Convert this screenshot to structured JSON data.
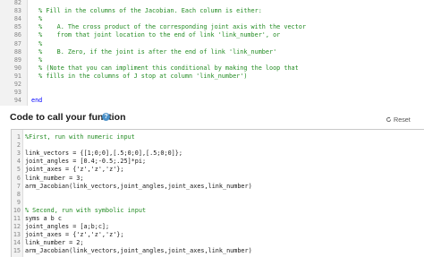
{
  "top_editor": {
    "lines": [
      {
        "n": "82",
        "text": "",
        "type": "plain"
      },
      {
        "n": "83",
        "text": "  % Fill in the columns of the Jacobian. Each column is either:",
        "type": "comment"
      },
      {
        "n": "84",
        "text": "  %",
        "type": "comment"
      },
      {
        "n": "85",
        "text": "  %    A. The cross product of the corresponding joint axis with the vector",
        "type": "comment"
      },
      {
        "n": "86",
        "text": "  %    from that joint location to the end of link 'link_number', or",
        "type": "comment"
      },
      {
        "n": "87",
        "text": "  %",
        "type": "comment"
      },
      {
        "n": "88",
        "text": "  %    B. Zero, if the joint is after the end of link 'link_number'",
        "type": "comment"
      },
      {
        "n": "89",
        "text": "  %",
        "type": "comment"
      },
      {
        "n": "90",
        "text": "  % (Note that you can impliment this conditional by making the loop that",
        "type": "comment"
      },
      {
        "n": "91",
        "text": "  % fills in the columns of J stop at column 'link_number')",
        "type": "comment"
      },
      {
        "n": "92",
        "text": "",
        "type": "plain"
      },
      {
        "n": "93",
        "text": "",
        "type": "plain"
      },
      {
        "n": "94",
        "text": "end",
        "type": "keyword"
      }
    ]
  },
  "section": {
    "title": "Code to call your function",
    "help_icon": "?",
    "reset_label": "Reset"
  },
  "bottom_editor": {
    "lines": [
      {
        "n": "1",
        "text": "%First, run with numeric input",
        "type": "comment"
      },
      {
        "n": "2",
        "text": "",
        "type": "plain"
      },
      {
        "n": "3",
        "text": "link_vectors = {[1;0;0],[.5;0;0],[.5;0;0]};",
        "type": "plain"
      },
      {
        "n": "4",
        "text": "joint_angles = [0.4;-0.5;.25]*pi;",
        "type": "plain"
      },
      {
        "n": "5",
        "text": "joint_axes = {'z','z','z'};",
        "type": "plain"
      },
      {
        "n": "6",
        "text": "link_number = 3;",
        "type": "plain"
      },
      {
        "n": "7",
        "text": "arm_Jacobian(link_vectors,joint_angles,joint_axes,link_number)",
        "type": "plain"
      },
      {
        "n": "8",
        "text": "",
        "type": "plain"
      },
      {
        "n": "9",
        "text": "",
        "type": "plain"
      },
      {
        "n": "10",
        "text": "% Second, run with symbolic input",
        "type": "comment"
      },
      {
        "n": "11",
        "text": "syms a b c",
        "type": "plain"
      },
      {
        "n": "12",
        "text": "joint_angles = [a;b;c];",
        "type": "plain"
      },
      {
        "n": "13",
        "text": "joint_axes = {'z','z','z'};",
        "type": "plain"
      },
      {
        "n": "14",
        "text": "link_number = 2;",
        "type": "plain"
      },
      {
        "n": "15",
        "text": "arm_Jacobian(link_vectors,joint_angles,joint_axes,link_number)",
        "type": "plain"
      }
    ]
  },
  "colors": {
    "comment": "#228b22",
    "keyword": "#0000ff",
    "string": "#a020f0",
    "help_icon": "#4a90c8"
  }
}
